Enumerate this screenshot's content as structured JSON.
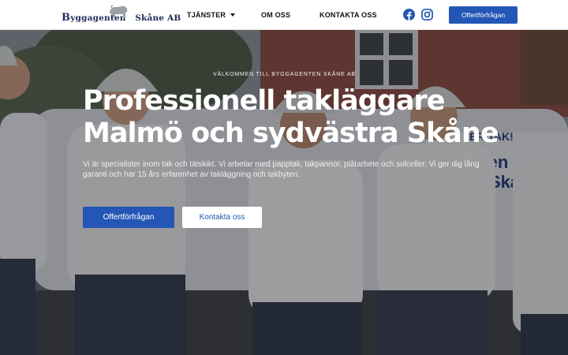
{
  "brand": {
    "logo_text": "Byggagenten Skåne AB",
    "logo_initial": "B",
    "logo_rest": "yggagenten",
    "logo_suffix": "Skåne AB",
    "color_primary": "#2356b6"
  },
  "nav": {
    "items": [
      {
        "label": "TJÄNSTER",
        "has_dropdown": true
      },
      {
        "label": "OM OSS"
      },
      {
        "label": "KONTAKTA OSS"
      }
    ],
    "social_icons": [
      "facebook-icon",
      "instagram-icon"
    ],
    "cta_label": "Offertförfrågan"
  },
  "hero": {
    "kicker": "VÄLKOMMEN TILL BYGGAGENTEN SKÅNE AB",
    "headline_line1": "Professionell takläggare",
    "headline_line2": "Malmö och sydvästra Skåne",
    "subtitle": "Vi är specialister inom tak och tätskikt. Vi arbetar med papptak, takpannor, plåtarbete och solceller. Vi ger dig lång garanti och har 15 års erfarenhet av takläggning och takbyten.",
    "primary_button": "Offertförfrågan",
    "secondary_button": "Kontakta oss",
    "background_image": "team of roofers in white shirts and hard hats in front of a van"
  }
}
